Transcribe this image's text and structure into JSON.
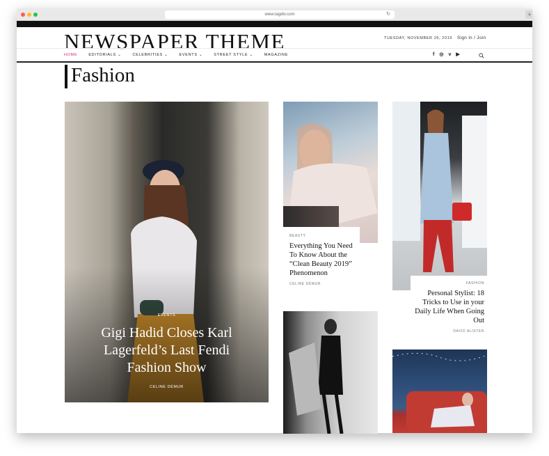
{
  "browser": {
    "url": "www.tagdiv.com",
    "reload_icon": "reload-icon",
    "new_tab_icon": "plus-icon"
  },
  "header": {
    "logo": "NEWSPAPER THEME",
    "date": "TUESDAY, NOVEMBER 26, 2019",
    "signin": "Sign in / Join"
  },
  "nav": {
    "items": [
      "HOME",
      "EDITORIALS",
      "CELEBRITIES",
      "EVENTS",
      "STREET STYLE",
      "MAGAZINE"
    ],
    "active": "HOME",
    "accent_color": "#d6237a"
  },
  "social": {
    "icons": [
      "facebook-icon",
      "instagram-icon",
      "vimeo-icon",
      "youtube-icon"
    ],
    "glyphs": [
      "f",
      "◎",
      "v",
      "▶"
    ]
  },
  "page": {
    "title": "Fashion"
  },
  "featured": {
    "category": "EVENTS",
    "title": "Gigi Hadid Closes Karl Lagerfeld’s Last Fendi Fashion Show",
    "author": "CELINE DÉMUR"
  },
  "posts": [
    {
      "category": "BEAUTY",
      "title": "Everything You Need To Know About the “Clean Beauty 2019” Phenomenon",
      "author": "CELINE DÉMUR"
    },
    {
      "category": "FASHION",
      "title": "Personal Stylist: 18 Tricks to Use in your Daily Life When Going Out",
      "author": "DAVID ALISTER"
    }
  ]
}
